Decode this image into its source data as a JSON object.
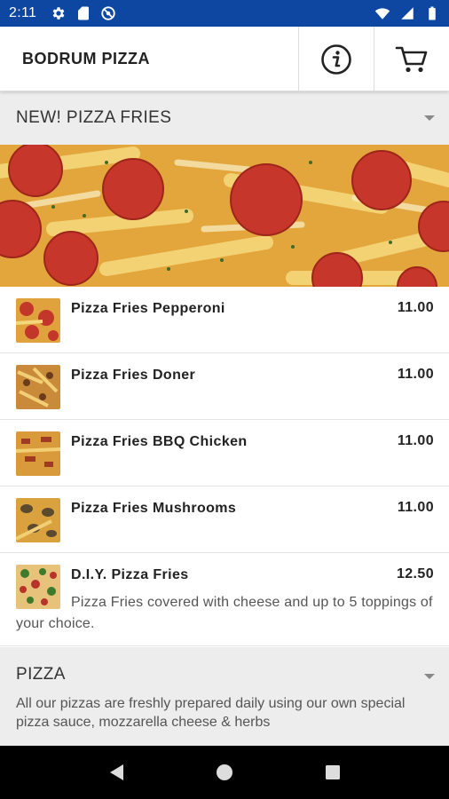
{
  "status_bar": {
    "time": "2:11",
    "left_icons": [
      "gear-icon",
      "sd-card-icon",
      "do-not-disturb-icon"
    ],
    "right_icons": [
      "wifi-icon",
      "signal-icon",
      "battery-icon"
    ],
    "background": "#0d47a1"
  },
  "header": {
    "title": "BODRUM PIZZA",
    "info_icon": "info-icon",
    "cart_icon": "cart-icon"
  },
  "sections": [
    {
      "title": "NEW! PIZZA FRIES",
      "banner_image": "pizza-fries-banner",
      "items": [
        {
          "name": "Pizza Fries Pepperoni",
          "price": "11.00",
          "description": ""
        },
        {
          "name": "Pizza Fries Doner",
          "price": "11.00",
          "description": ""
        },
        {
          "name": "Pizza Fries BBQ Chicken",
          "price": "11.00",
          "description": ""
        },
        {
          "name": "Pizza Fries Mushrooms",
          "price": "11.00",
          "description": ""
        },
        {
          "name": "D.I.Y. Pizza Fries",
          "price": "12.50",
          "description": "Pizza Fries covered with cheese and up to 5 toppings of your choice."
        }
      ]
    },
    {
      "title": "PIZZA",
      "description": "All our pizzas are freshly prepared daily using our own special pizza sauce, mozzarella cheese & herbs"
    }
  ],
  "nav_bar": {
    "back_icon": "back-triangle-icon",
    "home_icon": "home-circle-icon",
    "recents_icon": "recents-square-icon"
  }
}
